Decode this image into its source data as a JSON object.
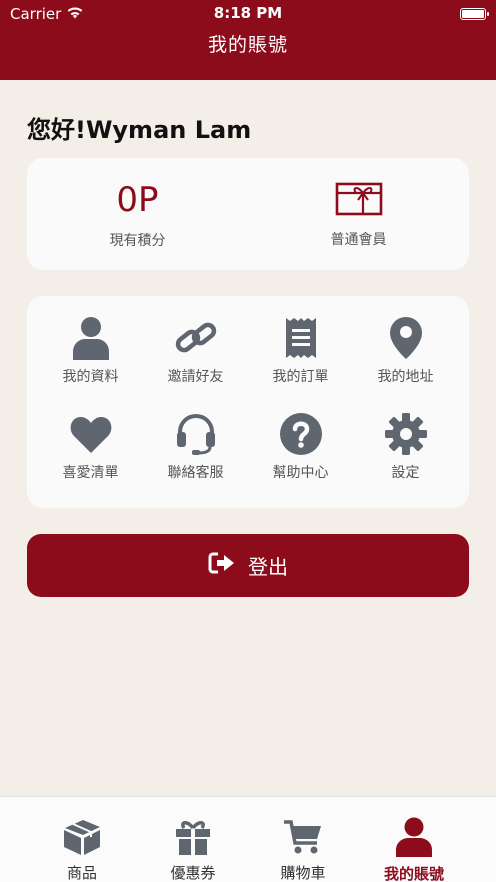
{
  "status_bar": {
    "carrier": "Carrier",
    "time": "8:18 PM"
  },
  "header": {
    "title": "我的賬號"
  },
  "greeting": "您好!Wyman Lam",
  "points": {
    "value": "0P",
    "label": "現有積分"
  },
  "membership": {
    "label": "普通會員",
    "icon": "gift-box-icon"
  },
  "menu": [
    {
      "label": "我的資料",
      "icon": "user-icon"
    },
    {
      "label": "邀請好友",
      "icon": "link-icon"
    },
    {
      "label": "我的訂單",
      "icon": "receipt-icon"
    },
    {
      "label": "我的地址",
      "icon": "map-pin-icon"
    },
    {
      "label": "喜愛清單",
      "icon": "heart-icon"
    },
    {
      "label": "聯絡客服",
      "icon": "headset-icon"
    },
    {
      "label": "幫助中心",
      "icon": "help-icon"
    },
    {
      "label": "設定",
      "icon": "gear-icon"
    }
  ],
  "logout": {
    "label": "登出",
    "icon": "logout-icon"
  },
  "tabs": [
    {
      "label": "商品",
      "icon": "box-icon",
      "active": false
    },
    {
      "label": "優惠券",
      "icon": "gift-icon",
      "active": false
    },
    {
      "label": "購物車",
      "icon": "cart-icon",
      "active": false
    },
    {
      "label": "我的賬號",
      "icon": "user-icon",
      "active": true
    }
  ],
  "colors": {
    "brand": "#8c0c1c",
    "icon_gray": "#5f6670",
    "background": "#f3efe8",
    "card": "#fafafa"
  }
}
